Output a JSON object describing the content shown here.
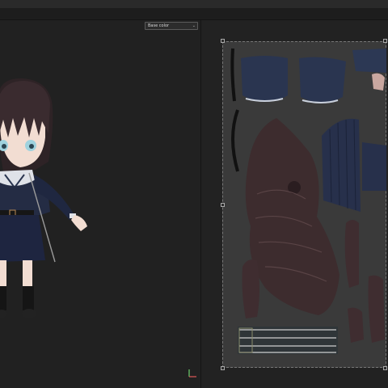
{
  "texture_channel_dropdown": {
    "label": "Base color",
    "caret": "⌄"
  },
  "icons": [
    "chevron-down-icon",
    "axis-gizmo-icon"
  ],
  "colors": {
    "background": "#1f1f1f",
    "uv_frame": "#3a3a3a",
    "uniform_navy": "#2a3550",
    "hair_brown": "#3d2c2e",
    "skin": "#f2ddd2"
  }
}
